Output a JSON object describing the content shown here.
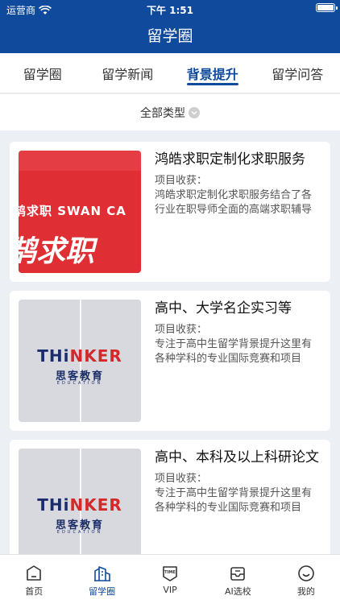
{
  "status": {
    "carrier": "运营商",
    "time": "下午 1:51"
  },
  "header": {
    "title": "留学圈"
  },
  "tabs": [
    {
      "label": "留学圈"
    },
    {
      "label": "留学新闻"
    },
    {
      "label": "背景提升"
    },
    {
      "label": "留学问答"
    }
  ],
  "active_tab": 2,
  "filter": {
    "label": "全部类型"
  },
  "cards": [
    {
      "name": "鸿皓求职定制化求职服务",
      "label": "项目收获：",
      "desc": "鸿皓求职定制化求职服务结合了各行业在职导师全面的高端求职辅导",
      "logo_small": "鹄求职 SWAN CA",
      "logo_big": "鹄求职"
    },
    {
      "name": "高中、大学名企实习等",
      "label": "项目收获：",
      "desc": "专注于高中生留学背景提升这里有各种学科的专业国际竞赛和项目",
      "logo_a": "THi",
      "logo_b": "NKER",
      "logo_sub": "思客教育",
      "logo_edu": "EDUCATION"
    },
    {
      "name": "高中、本科及以上科研论文",
      "label": "项目收获：",
      "desc": "专注于高中生留学背景提升这里有各种学科的专业国际竞赛和项目",
      "logo_a": "THi",
      "logo_b": "NKER",
      "logo_sub": "思客教育",
      "logo_edu": "EDUCATION"
    }
  ],
  "tabbar": [
    {
      "label": "首页",
      "icon": "home-icon"
    },
    {
      "label": "留学圈",
      "icon": "buildings-icon"
    },
    {
      "label": "VIP",
      "icon": "time-badge-icon"
    },
    {
      "label": "AI选校",
      "icon": "inbox-icon"
    },
    {
      "label": "我的",
      "icon": "smile-icon"
    }
  ],
  "colors": {
    "brand": "#0f4a9c",
    "swan_red": "#df2f35",
    "thinker_navy": "#1b2c6a"
  }
}
